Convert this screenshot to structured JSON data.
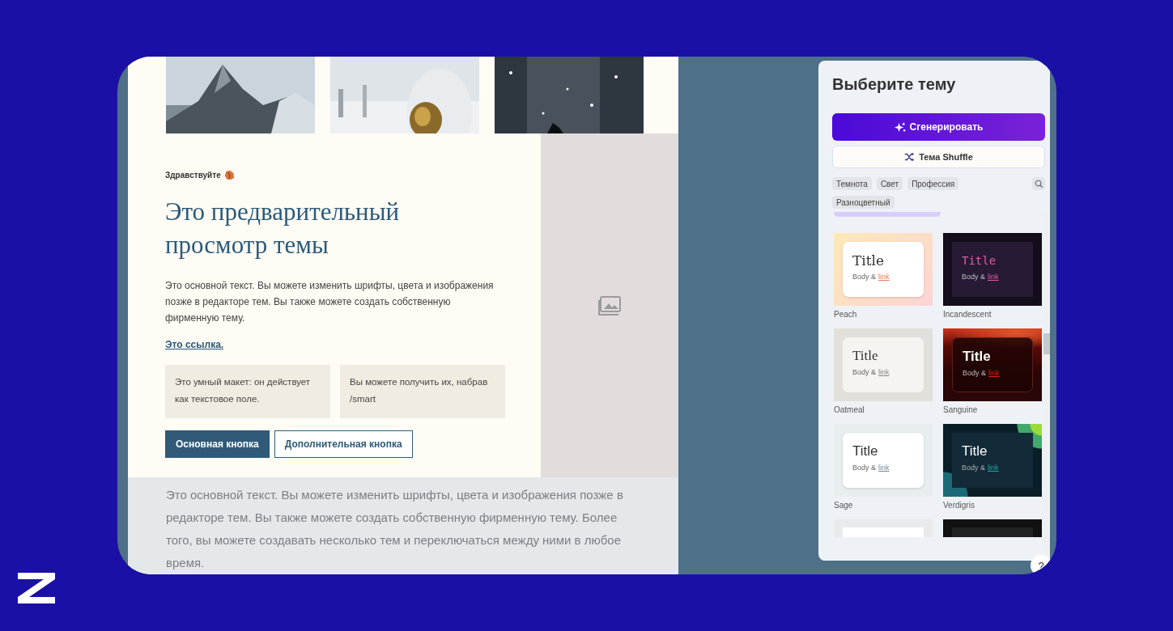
{
  "preview": {
    "greeting": "Здравствуйте",
    "heading": "Это предварительный просмотр темы",
    "body": "Это основной текст. Вы можете изменить шрифты, цвета и изображения позже в редакторе тем. Вы также можете создать собственную фирменную тему.",
    "link": "Это ссылка.",
    "smart_boxes": [
      "Это умный макет: он действует как текстовое поле.",
      "Вы можете получить их, набрав /smart"
    ],
    "buttons": [
      {
        "label": "Основная кнопка",
        "kind": "primary"
      },
      {
        "label": "Дополнительная кнопка",
        "kind": "secondary"
      }
    ],
    "footer_text": "Это основной текст. Вы можете изменить шрифты, цвета и изображения позже в редакторе тем. Вы также можете создать собственную фирменную тему. Более того, вы можете создавать несколько тем и переключаться между ними в любое время."
  },
  "panel": {
    "title": "Выберите тему",
    "generate_button": "Сгенерировать",
    "shuffle_button": "Тема Shuffle",
    "filters": [
      "Темнота",
      "Свет",
      "Профессия",
      "Разноцветный"
    ],
    "themes": [
      {
        "kind": "peach",
        "name": "Peach",
        "title": "Title",
        "body": "Body &",
        "link": "link"
      },
      {
        "kind": "incandescent",
        "name": "Incandescent",
        "title": "Title",
        "body": "Body &",
        "link": "link"
      },
      {
        "kind": "oatmeal",
        "name": "Oatmeal",
        "title": "Title",
        "body": "Body &",
        "link": "link"
      },
      {
        "kind": "sanguine",
        "name": "Sanguine",
        "title": "Title",
        "body": "Body &",
        "link": "link"
      },
      {
        "kind": "sage",
        "name": "Sage",
        "title": "Title",
        "body": "Body &",
        "link": "link"
      },
      {
        "kind": "verdigris",
        "name": "Verdigris",
        "title": "Title",
        "body": "Body &",
        "link": "link"
      },
      {
        "kind": "light"
      },
      {
        "kind": "dark"
      }
    ],
    "help": "?"
  }
}
